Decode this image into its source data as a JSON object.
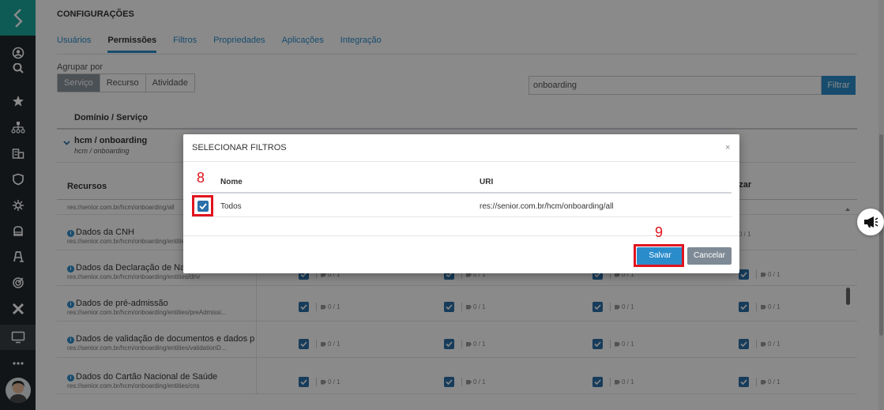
{
  "page": {
    "title": "CONFIGURAÇÕES",
    "tabs": [
      {
        "label": "Usuários"
      },
      {
        "label": "Permissões"
      },
      {
        "label": "Filtros"
      },
      {
        "label": "Propriedades"
      },
      {
        "label": "Aplicações"
      },
      {
        "label": "Integração"
      }
    ],
    "active_tab": "Permissões",
    "group_label": "Agrupar por",
    "group_options": [
      {
        "label": "Serviço"
      },
      {
        "label": "Recurso"
      },
      {
        "label": "Atividade"
      }
    ],
    "filter_value": "onboarding",
    "filter_button": "Filtrar"
  },
  "table": {
    "col_domain": "Domínio / Serviço",
    "service": {
      "name": "hcm / onboarding",
      "sub": "hcm / onboarding"
    },
    "col_resources": "Recursos",
    "col_view": "alizar",
    "rows": [
      {
        "title": "",
        "uri": "res://senior.com.br/hcm/onboarding/all",
        "count": ""
      },
      {
        "title": "Dados da CNH",
        "uri": "res://senior.com.br/hcm/onboarding/entities/cnh",
        "count": "0 / 1"
      },
      {
        "title": "Dados da Declaração de Nascido Vivo",
        "uri": "res://senior.com.br/hcm/onboarding/entities/dnv",
        "count": "0 / 1"
      },
      {
        "title": "Dados de pré-admissão",
        "uri": "res://senior.com.br/hcm/onboarding/entities/preAdmissi...",
        "count": "0 / 1"
      },
      {
        "title": "Dados de validação de documentos e dados p...",
        "uri": "res://senior.com.br/hcm/onboarding/entities/validationD...",
        "count": "0 / 1"
      },
      {
        "title": "Dados do Cartão Nacional de Saúde",
        "uri": "res://senior.com.br/hcm/onboarding/entities/cns",
        "count": "0 / 1"
      }
    ]
  },
  "modal": {
    "title": "SELECIONAR FILTROS",
    "close": "×",
    "col_name": "Nome",
    "col_uri": "URI",
    "row": {
      "name": "Todos",
      "uri": "res://senior.com.br/hcm/onboarding/all",
      "checked": true
    },
    "save_button": "Salvar",
    "cancel_button": "Cancelar"
  },
  "annotations": {
    "step_checkbox": "8",
    "step_save": "9",
    "color": "#e0141e"
  },
  "icons": {
    "sidebar": [
      "senior-logo-icon",
      "user-circle-icon",
      "search-icon",
      "star-icon",
      "org-chart-icon",
      "building-icon",
      "shield-icon",
      "network-icon",
      "stack-icon",
      "people-icon",
      "target-icon",
      "x-logo-icon",
      "monitor-icon",
      "more-icon"
    ]
  },
  "colors": {
    "sidebar_bg": "#22272d",
    "logo_bg": "#19a89c",
    "accent": "#2b8ccb",
    "checkbox": "#2b6fa8",
    "cancel": "#7e8a95"
  }
}
